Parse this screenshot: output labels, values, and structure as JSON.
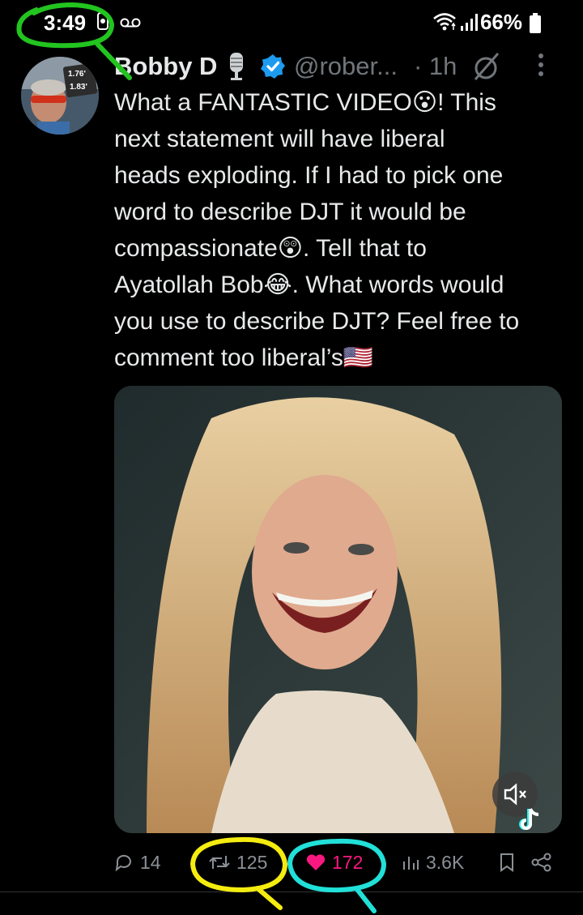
{
  "status_bar": {
    "time": "3:49",
    "battery": "66%"
  },
  "tweet": {
    "display_name": "Bobby D",
    "handle": "@rober...",
    "time_ago": "· 1h",
    "text": "What a FANTASTIC VIDEO😮! This\nnext statement will have liberal\nheads exploding. If I had to pick one\nword to describe DJT it would be\ncompassionate😲. Tell that to\nAyatollah Bob😂. What words would\nyou use to describe DJT? Feel free to\ncomment too liberal’s🇺🇸"
  },
  "avatar_sign": {
    "line1": "1.76'",
    "line2": "1.83'"
  },
  "actions": {
    "replies": "14",
    "reposts": "125",
    "likes": "172",
    "views": "3.6K"
  },
  "colors": {
    "background": "#000000",
    "verified": "#1d9bf0",
    "like": "#f91880",
    "annotation_green": "#22c41f",
    "annotation_yellow": "#f5ec10",
    "annotation_cyan": "#21e0d8"
  },
  "icons": [
    "wifi-icon",
    "signal-icon",
    "battery-icon",
    "verified-badge-icon",
    "grok-icon",
    "more-icon",
    "reply-icon",
    "repost-icon",
    "like-icon",
    "views-icon",
    "bookmark-icon",
    "share-icon",
    "mute-icon",
    "tiktok-icon"
  ]
}
